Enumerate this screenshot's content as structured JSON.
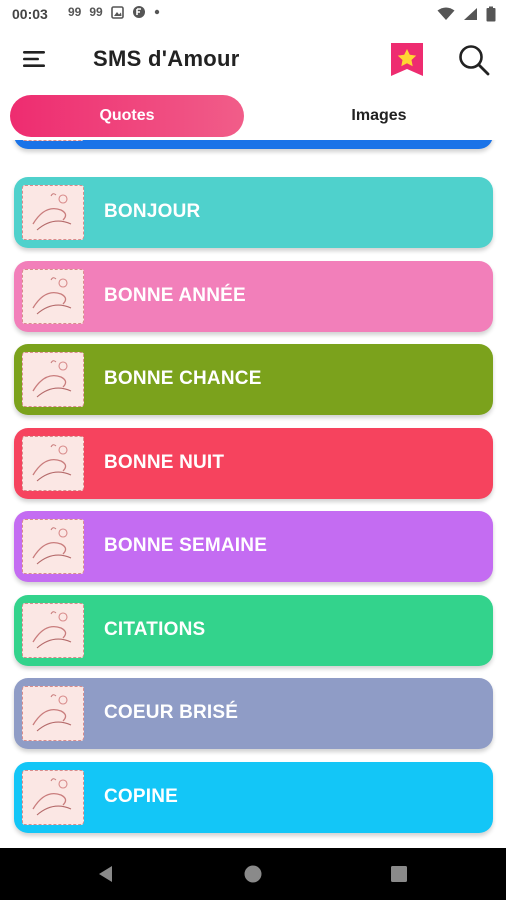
{
  "status_bar": {
    "time": "00:03",
    "notifications": [
      "99",
      "99"
    ]
  },
  "app_bar": {
    "title": "SMS d'Amour",
    "icons": [
      "menu-icon",
      "favorites-star-icon",
      "search-icon"
    ]
  },
  "tabs": [
    {
      "label": "Quotes",
      "active": true
    },
    {
      "label": "Images",
      "active": false
    }
  ],
  "categories": [
    {
      "label": "",
      "color": "#1a73e8"
    },
    {
      "label": "BONJOUR",
      "color": "#4fd1cc"
    },
    {
      "label": "BONNE ANNÉE",
      "color": "#f27fba"
    },
    {
      "label": "BONNE CHANCE",
      "color": "#7ba21c"
    },
    {
      "label": "BONNE NUIT",
      "color": "#f6435e"
    },
    {
      "label": "BONNE SEMAINE",
      "color": "#c46cf2"
    },
    {
      "label": "CITATIONS",
      "color": "#33d38c"
    },
    {
      "label": "COEUR BRISÉ",
      "color": "#8f9cc6"
    },
    {
      "label": "COPINE",
      "color": "#13c6f7"
    }
  ],
  "theme": {
    "accent": "#ee2c70",
    "nav_bar": "#000000"
  }
}
